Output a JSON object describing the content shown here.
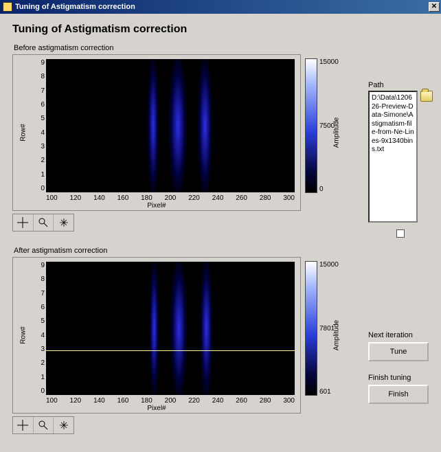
{
  "window": {
    "title": "Tuning of Astigmatism correction",
    "close_glyph": "✕"
  },
  "page": {
    "heading": "Tuning of Astigmatism correction"
  },
  "labels": {
    "before": "Before astigmatism correction",
    "after": "After astigmatism correction",
    "path": "Path",
    "next_iter": "Next iteration",
    "finish_tuning": "Finish tuning"
  },
  "buttons": {
    "tune": "Tune",
    "finish": "Finish"
  },
  "axes": {
    "ylabel": "Row#",
    "xlabel": "Pixel#",
    "yticks": [
      "9",
      "8",
      "7",
      "6",
      "5",
      "4",
      "3",
      "2",
      "1",
      "0"
    ],
    "xticks": [
      "100",
      "120",
      "140",
      "160",
      "180",
      "200",
      "220",
      "240",
      "260",
      "280",
      "300"
    ]
  },
  "colorbar": {
    "label": "Amplitude",
    "before": {
      "max": "15000",
      "mid": "7500",
      "min": "0"
    },
    "after": {
      "max": "15000",
      "mid": "7801",
      "min": "601"
    }
  },
  "path_value": "D:\\Data\\120626-Preview-Data-Simone\\Astigmatism-file-from-Ne-Lines-9x1340bins.txt",
  "chart_data": [
    {
      "type": "heatmap",
      "title": "Before astigmatism correction",
      "xlabel": "Pixel#",
      "ylabel": "Row#",
      "zlabel": "Amplitude",
      "xlim": [
        100,
        300
      ],
      "ylim": [
        0,
        9
      ],
      "zlim": [
        0,
        15000
      ],
      "xticks": [
        100,
        120,
        140,
        160,
        180,
        200,
        220,
        240,
        260,
        280,
        300
      ],
      "yticks": [
        0,
        1,
        2,
        3,
        4,
        5,
        6,
        7,
        8,
        9
      ],
      "peaks_x": [
        183,
        205,
        225
      ],
      "peak_widths": [
        8,
        14,
        10
      ],
      "note": "vertical spectral lines, fairly uniform across rows"
    },
    {
      "type": "heatmap",
      "title": "After astigmatism correction",
      "xlabel": "Pixel#",
      "ylabel": "Row#",
      "zlabel": "Amplitude",
      "xlim": [
        100,
        300
      ],
      "ylim": [
        0,
        9
      ],
      "zlim": [
        601,
        15000
      ],
      "xticks": [
        100,
        120,
        140,
        160,
        180,
        200,
        220,
        240,
        260,
        280,
        300
      ],
      "yticks": [
        0,
        1,
        2,
        3,
        4,
        5,
        6,
        7,
        8,
        9
      ],
      "peaks_x": [
        183,
        205,
        225
      ],
      "peak_widths": [
        7,
        12,
        9
      ],
      "cursor_row": 3,
      "note": "same lines, slightly sharper; horizontal cursor at row 3"
    }
  ]
}
